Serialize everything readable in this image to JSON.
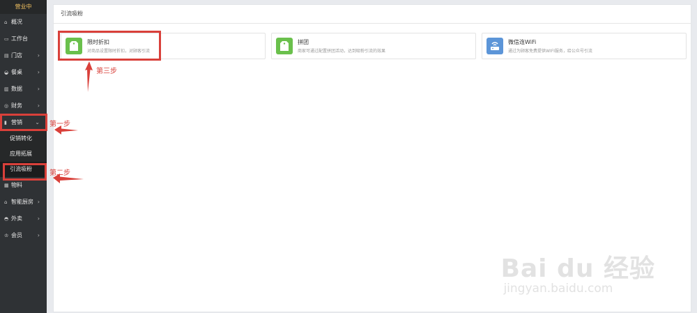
{
  "sidebar": {
    "status": "营业中",
    "items": [
      {
        "icon": "home-icon",
        "glyph": "⌂",
        "label": "概况"
      },
      {
        "icon": "monitor-icon",
        "glyph": "▭",
        "label": "工作台"
      },
      {
        "icon": "store-icon",
        "glyph": "▤",
        "label": "门店",
        "chevron": "›"
      },
      {
        "icon": "dish-icon",
        "glyph": "◒",
        "label": "餐桌",
        "chevron": "›"
      },
      {
        "icon": "chart-icon",
        "glyph": "▥",
        "label": "数据",
        "chevron": "›"
      },
      {
        "icon": "finance-icon",
        "glyph": "◎",
        "label": "财务",
        "chevron": "›"
      },
      {
        "icon": "marketing-icon",
        "glyph": "▮",
        "label": "营销",
        "chevron": "⌄"
      },
      {
        "icon": "material-icon",
        "glyph": "▦",
        "label": "物料"
      },
      {
        "icon": "kitchen-icon",
        "glyph": "⌂",
        "label": "智能厨房",
        "chevron": "›"
      },
      {
        "icon": "takeout-icon",
        "glyph": "◓",
        "label": "外卖",
        "chevron": "›"
      },
      {
        "icon": "member-icon",
        "glyph": "♔",
        "label": "会员",
        "chevron": "›"
      }
    ],
    "sub_items": [
      "促销转化",
      "应用拓展",
      "引流吸粉"
    ]
  },
  "panel": {
    "title": "引流吸粉",
    "cards": [
      {
        "name": "限时折扣",
        "desc": "对商品设置限时折扣，对顾客引流",
        "icon": "tag-icon",
        "color": "#6ac04c"
      },
      {
        "name": "拼团",
        "desc": "商家可通过配置拼团活动，达到吸粉引流的效果",
        "icon": "tag-icon",
        "color": "#6ac04c"
      },
      {
        "name": "微信连WiFi",
        "desc": "通过为顾客免费提供WIFI服务，给公众号引流",
        "icon": "wifi-router-icon",
        "color": "#5c95d8"
      }
    ]
  },
  "annotations": {
    "step1": "第一步",
    "step2": "第二步",
    "step3": "第三步",
    "color": "#d9403a"
  },
  "watermark": {
    "main": "Bai du 经验",
    "sub": "jingyan.baidu.com"
  }
}
